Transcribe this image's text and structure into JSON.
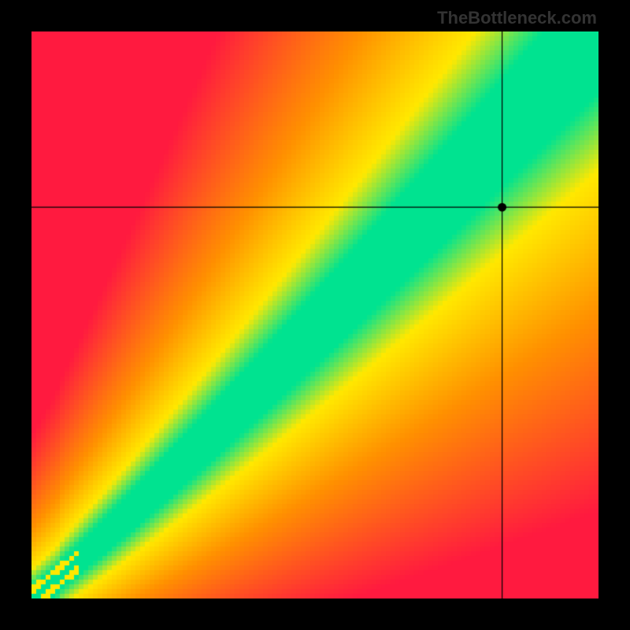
{
  "watermark": "TheBottleneck.com",
  "chart_data": {
    "type": "heatmap",
    "title": "",
    "xlabel": "",
    "ylabel": "",
    "xlim": [
      0,
      100
    ],
    "ylim": [
      0,
      100
    ],
    "marker": {
      "x": 83,
      "y": 69
    },
    "crosshair": {
      "x": 83,
      "y": 69
    },
    "optimal_curve": {
      "description": "Green diagonal band representing optimal balance",
      "points": [
        {
          "x": 0,
          "y": 0
        },
        {
          "x": 20,
          "y": 18
        },
        {
          "x": 40,
          "y": 38
        },
        {
          "x": 60,
          "y": 60
        },
        {
          "x": 80,
          "y": 82
        },
        {
          "x": 100,
          "y": 100
        }
      ]
    },
    "color_scale": {
      "optimal": "#00E390",
      "good": "#FFE800",
      "moderate": "#FF9000",
      "bottleneck": "#FF1A3F"
    }
  }
}
